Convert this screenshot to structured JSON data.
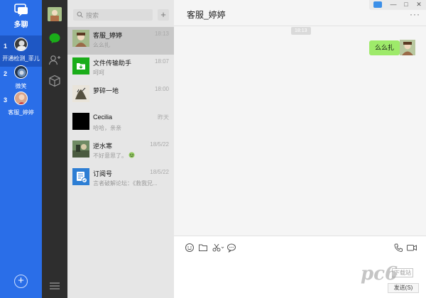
{
  "accounts_panel": {
    "logo_label": "多聊",
    "items": [
      {
        "index": "1",
        "name": "开通检测_菲儿",
        "active": true
      },
      {
        "index": "2",
        "name": "微笑",
        "active": false
      },
      {
        "index": "3",
        "name": "客服_婷婷",
        "active": false
      }
    ],
    "add_label": "+"
  },
  "search": {
    "placeholder": "搜索"
  },
  "add_button": "+",
  "conversations": [
    {
      "title": "客服_婷婷",
      "time": "18:13",
      "preview": "么么扎",
      "selected": true
    },
    {
      "title": "文件传输助手",
      "time": "18:07",
      "preview": "呵呵",
      "selected": false
    },
    {
      "title": "萝碎一地",
      "time": "18:00",
      "preview": "",
      "selected": false
    },
    {
      "title": "Cecilia",
      "time": "昨天",
      "preview": "哈哈，亲亲",
      "selected": false
    },
    {
      "title": "逆水寒",
      "time": "18/5/22",
      "preview": "不好意思了。",
      "selected": false
    },
    {
      "title": "订阅号",
      "time": "18/5/22",
      "preview": "言者破解论坛：《救我兄...",
      "selected": false
    }
  ],
  "chat": {
    "title": "客服_婷婷",
    "more": "···",
    "timestamp": "18:13",
    "message": "么么扎",
    "send_label": "发送(S)"
  },
  "window_controls": {
    "minimize": "—",
    "maximize": "□",
    "close": "✕"
  },
  "watermark": {
    "text": "pc6",
    "sub": "下载站"
  },
  "colors": {
    "accent_blue": "#2a6ee8",
    "bubble_green": "#9eea6a",
    "nav_dark": "#2e2e2e",
    "wechat_green": "#1aad19"
  }
}
